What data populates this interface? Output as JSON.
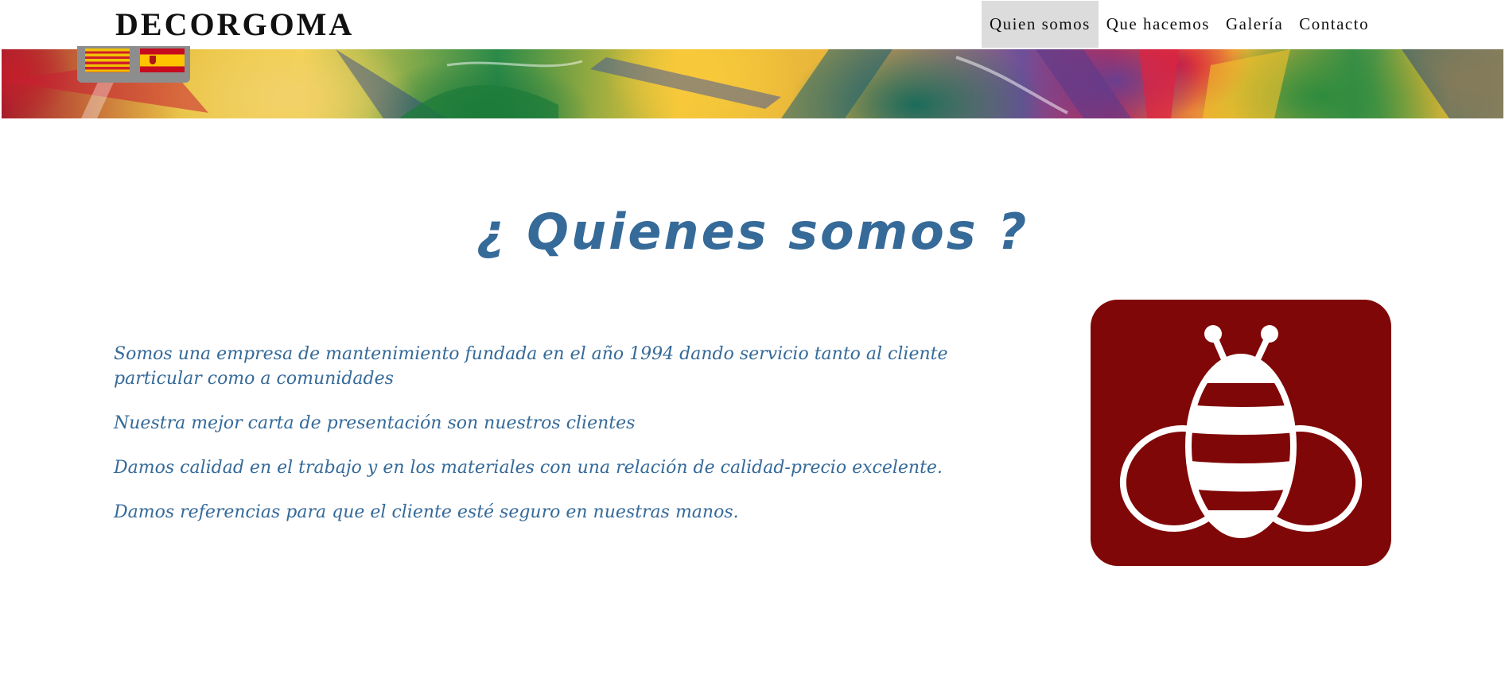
{
  "header": {
    "brand": "DECORGOMA",
    "nav": [
      {
        "label": "Quien somos",
        "active": true
      },
      {
        "label": "Que hacemos",
        "active": false
      },
      {
        "label": "Galería",
        "active": false
      },
      {
        "label": "Contacto",
        "active": false
      }
    ]
  },
  "language_flags": [
    {
      "icon": "catalan-flag-icon"
    },
    {
      "icon": "spanish-flag-icon"
    }
  ],
  "main": {
    "title": "¿ Quienes somos ?",
    "paragraphs": [
      "Somos una empresa de mantenimiento fundada en el año 1994 dando servicio tanto al cliente particular como a comunidades",
      "Nuestra mejor carta de presentación son nuestros clientes",
      "Damos calidad en el trabajo y en los materiales con una relación de calidad-precio excelente.",
      "Damos referencias para que el cliente esté seguro en nuestras manos."
    ],
    "image": {
      "icon": "bee-icon"
    }
  },
  "colors": {
    "accent_text": "#356a99",
    "bee_background": "#800707",
    "nav_active_bg": "#dcdcdc",
    "flags_box": "#8d8d8d"
  }
}
